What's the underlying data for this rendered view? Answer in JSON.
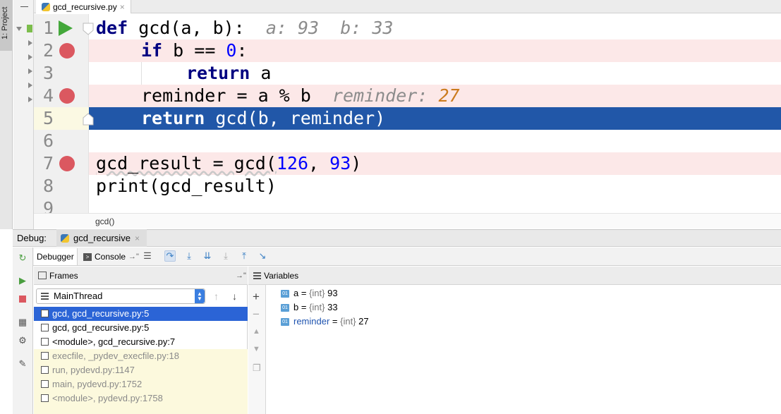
{
  "window": {
    "project_tab": "1: Project"
  },
  "editor": {
    "file_tab": "gcd_recursive.py",
    "lines": [
      {
        "n": "1"
      },
      {
        "n": "2"
      },
      {
        "n": "3"
      },
      {
        "n": "4"
      },
      {
        "n": "5"
      },
      {
        "n": "6"
      },
      {
        "n": "7"
      },
      {
        "n": "8"
      },
      {
        "n": "9"
      }
    ],
    "code": {
      "l1_def": "def",
      "l1_sig": " gcd(a, b):",
      "l1_hint": "  a: 93  b: 33",
      "l2_if": "if",
      "l2_cond": " b == ",
      "l2_zero": "0",
      "l2_colon": ":",
      "l3_ret": "return",
      "l3_rest": " a",
      "l4_text": "reminder = a % b",
      "l4_hint_name": "  reminder: ",
      "l4_hint_val": "27",
      "l5_ret": "return",
      "l5_rest": " gcd(b, reminder)",
      "l7_a": "gcd_result = gcd(",
      "l7_n1": "126",
      "l7_comma": ", ",
      "l7_n2": "93",
      "l7_end": ")",
      "l8_text": "print(gcd_result)"
    },
    "breadcrumb": "gcd()"
  },
  "debug": {
    "label": "Debug:",
    "session_tab": "gcd_recursive",
    "tabs": {
      "debugger": "Debugger",
      "console": "Console"
    },
    "frames_header": "Frames",
    "variables_header": "Variables",
    "thread": "MainThread",
    "frames": [
      {
        "label": "gcd, gcd_recursive.py:5"
      },
      {
        "label": "gcd, gcd_recursive.py:5"
      },
      {
        "label": "<module>, gcd_recursive.py:7"
      },
      {
        "label": "execfile, _pydev_execfile.py:18"
      },
      {
        "label": "run, pydevd.py:1147"
      },
      {
        "label": "main, pydevd.py:1752"
      },
      {
        "label": "<module>, pydevd.py:1758"
      }
    ],
    "variables": [
      {
        "name": "a",
        "eq": " = ",
        "type": "{int}",
        "value": " 93"
      },
      {
        "name": "b",
        "eq": " = ",
        "type": "{int}",
        "value": " 33"
      },
      {
        "name": "reminder",
        "eq": " = ",
        "type": "{int}",
        "value": " 27"
      }
    ],
    "var_icon_text": "01"
  },
  "colors": {
    "selection": "#2157a8",
    "breakpoint_line": "#fce8e8",
    "breakpoint": "#db5860",
    "frame_selected": "#2b64d6",
    "library_frame": "#fcf9dd"
  }
}
